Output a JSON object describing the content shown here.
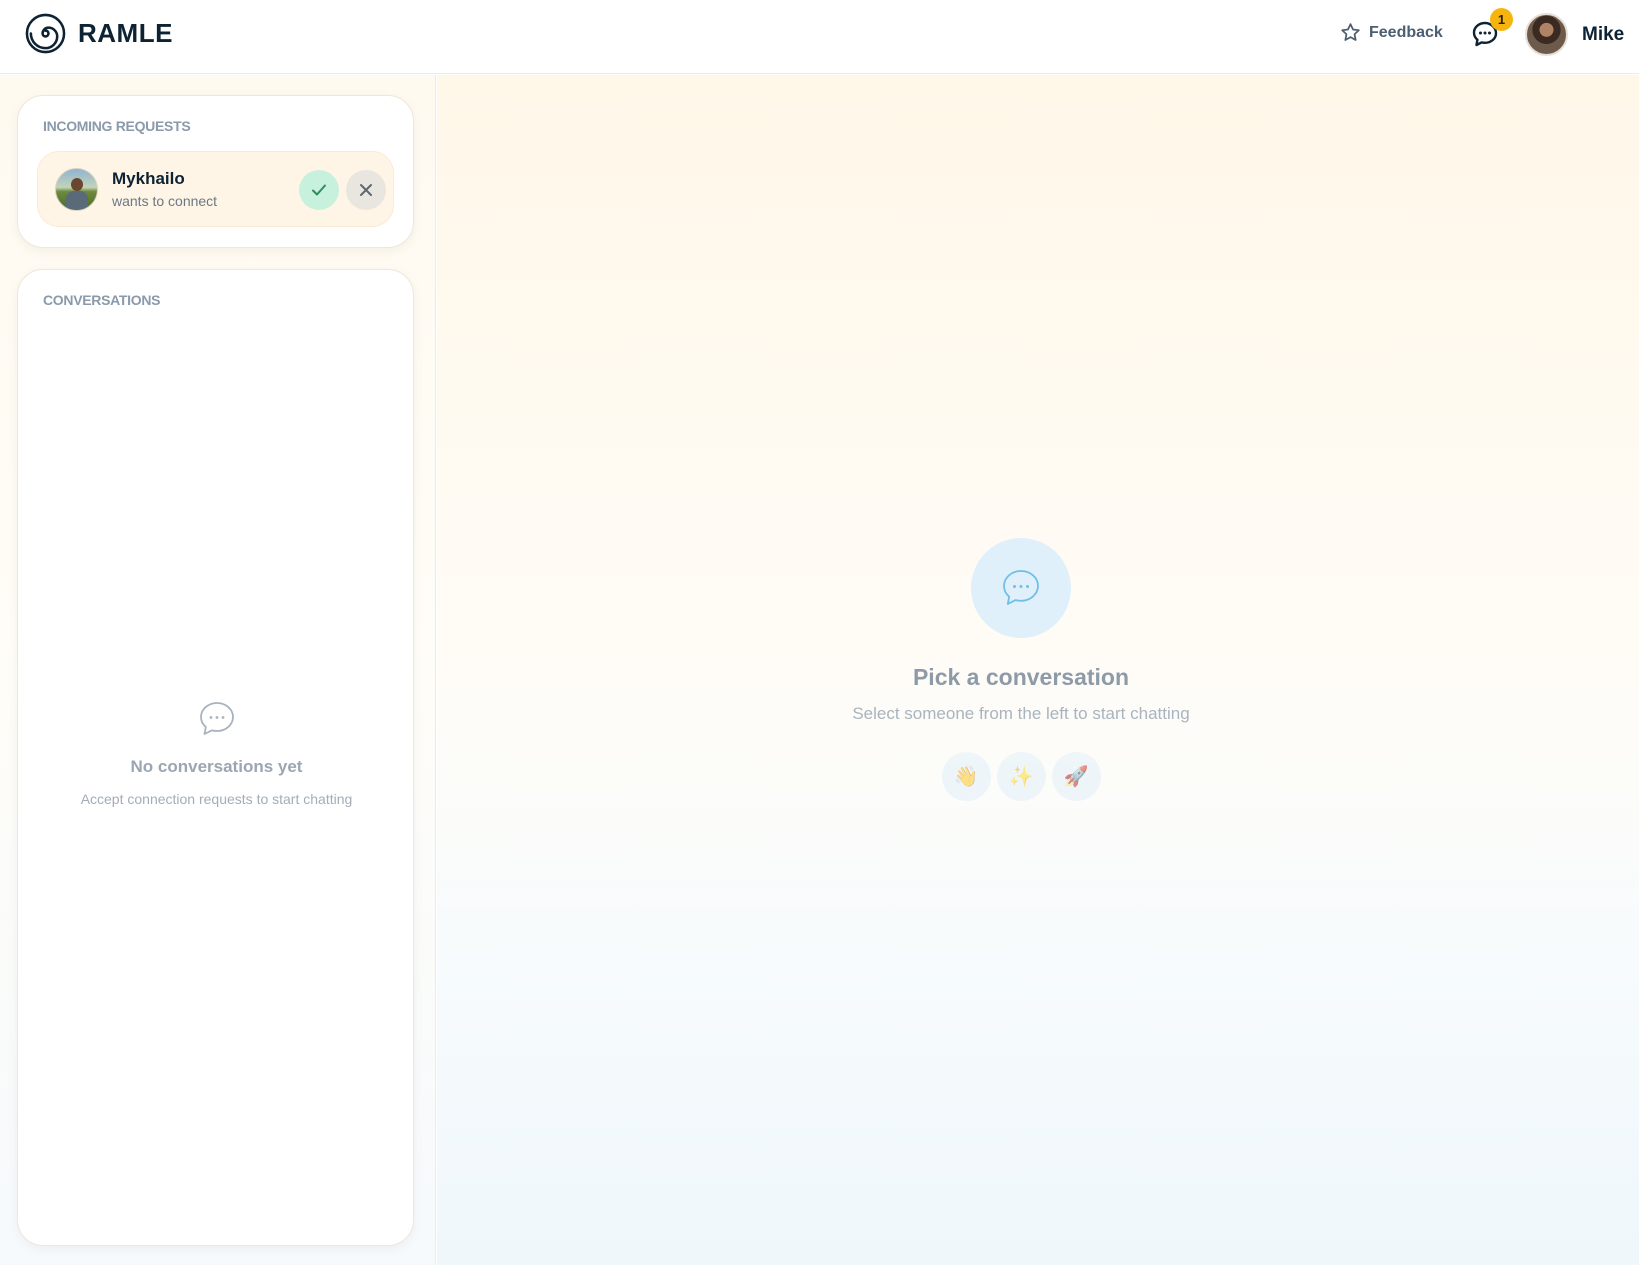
{
  "app": {
    "brand": "RAMLE"
  },
  "header": {
    "feedback_label": "Feedback",
    "messages_badge": "1",
    "user_name": "Mike"
  },
  "requests": {
    "title": "INCOMING REQUESTS",
    "items": [
      {
        "name": "Mykhailo",
        "subtitle": "wants to connect"
      }
    ]
  },
  "conversations": {
    "title": "CONVERSATIONS",
    "empty_title": "No conversations yet",
    "empty_sub": "Accept connection requests to start chatting"
  },
  "main": {
    "title": "Pick a conversation",
    "subtitle": "Select someone from the left to start chatting",
    "emojis": [
      "👋",
      "✨",
      "🚀"
    ]
  },
  "colors": {
    "accent_green": "#c8f1dd",
    "badge_yellow": "#f6b40e",
    "request_bg": "#fff5e6"
  }
}
